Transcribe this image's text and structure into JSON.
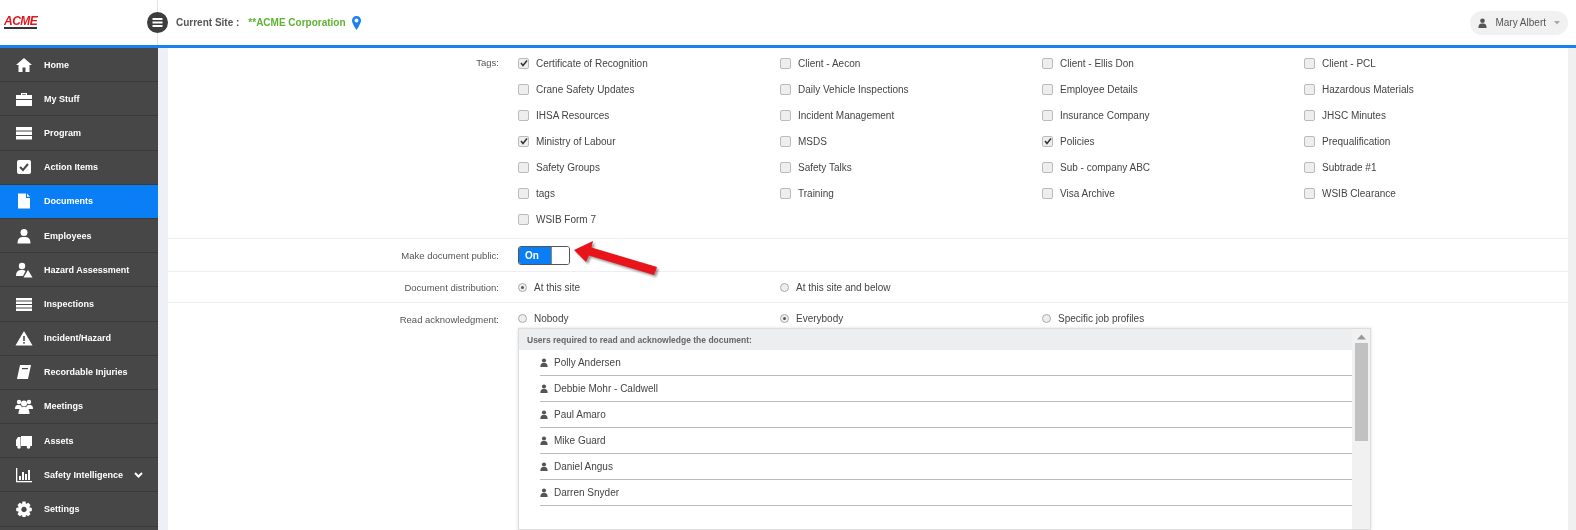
{
  "header": {
    "logo": "ACME",
    "site_label": "Current Site :",
    "site_name": "**ACME Corporation",
    "user_name": "Mary Albert"
  },
  "sidebar": {
    "items": [
      {
        "label": "Home",
        "selected": false,
        "has_submenu": false
      },
      {
        "label": "My Stuff",
        "selected": false,
        "has_submenu": false
      },
      {
        "label": "Program",
        "selected": false,
        "has_submenu": false
      },
      {
        "label": "Action Items",
        "selected": false,
        "has_submenu": false
      },
      {
        "label": "Documents",
        "selected": true,
        "has_submenu": false
      },
      {
        "label": "Employees",
        "selected": false,
        "has_submenu": false
      },
      {
        "label": "Hazard Assessment",
        "selected": false,
        "has_submenu": false
      },
      {
        "label": "Inspections",
        "selected": false,
        "has_submenu": false
      },
      {
        "label": "Incident/Hazard",
        "selected": false,
        "has_submenu": false
      },
      {
        "label": "Recordable Injuries",
        "selected": false,
        "has_submenu": false
      },
      {
        "label": "Meetings",
        "selected": false,
        "has_submenu": false
      },
      {
        "label": "Assets",
        "selected": false,
        "has_submenu": false
      },
      {
        "label": "Safety Intelligence",
        "selected": false,
        "has_submenu": true
      },
      {
        "label": "Settings",
        "selected": false,
        "has_submenu": false
      }
    ]
  },
  "form": {
    "tags": {
      "label": "Tags:",
      "options": [
        {
          "label": "Certificate of Recognition",
          "checked": true
        },
        {
          "label": "Client - Aecon",
          "checked": false
        },
        {
          "label": "Client - Ellis Don",
          "checked": false
        },
        {
          "label": "Client - PCL",
          "checked": false
        },
        {
          "label": "Crane Safety Updates",
          "checked": false
        },
        {
          "label": "Daily Vehicle Inspections",
          "checked": false
        },
        {
          "label": "Employee Details",
          "checked": false
        },
        {
          "label": "Hazardous Materials",
          "checked": false
        },
        {
          "label": "IHSA Resources",
          "checked": false
        },
        {
          "label": "Incident Management",
          "checked": false
        },
        {
          "label": "Insurance Company",
          "checked": false
        },
        {
          "label": "JHSC Minutes",
          "checked": false
        },
        {
          "label": "Ministry of Labour",
          "checked": true
        },
        {
          "label": "MSDS",
          "checked": false
        },
        {
          "label": "Policies",
          "checked": true
        },
        {
          "label": "Prequalification",
          "checked": false
        },
        {
          "label": "Safety Groups",
          "checked": false
        },
        {
          "label": "Safety Talks",
          "checked": false
        },
        {
          "label": "Sub - company ABC",
          "checked": false
        },
        {
          "label": "Subtrade #1",
          "checked": false
        },
        {
          "label": "tags",
          "checked": false
        },
        {
          "label": "Training",
          "checked": false
        },
        {
          "label": "Visa Archive",
          "checked": false
        },
        {
          "label": "WSIB Clearance",
          "checked": false
        },
        {
          "label": "WSIB Form 7",
          "checked": false
        }
      ]
    },
    "public": {
      "label": "Make document public:",
      "on": true,
      "text": "On"
    },
    "distribution": {
      "label": "Document distribution:",
      "options": [
        {
          "label": "At this site",
          "selected": true
        },
        {
          "label": "At this site and below",
          "selected": false
        }
      ]
    },
    "acknowledgment": {
      "label": "Read acknowledgment:",
      "options": [
        {
          "label": "Nobody",
          "selected": false
        },
        {
          "label": "Everybody",
          "selected": true
        },
        {
          "label": "Specific job profiles",
          "selected": false
        }
      ],
      "users_list": {
        "header": "Users required to read and acknowledge the document:",
        "users": [
          "Polly Andersen",
          "Debbie Mohr - Caldwell",
          "Paul Amaro",
          "Mike Guard",
          "Daniel Angus",
          "Darren Snyder"
        ]
      }
    }
  }
}
